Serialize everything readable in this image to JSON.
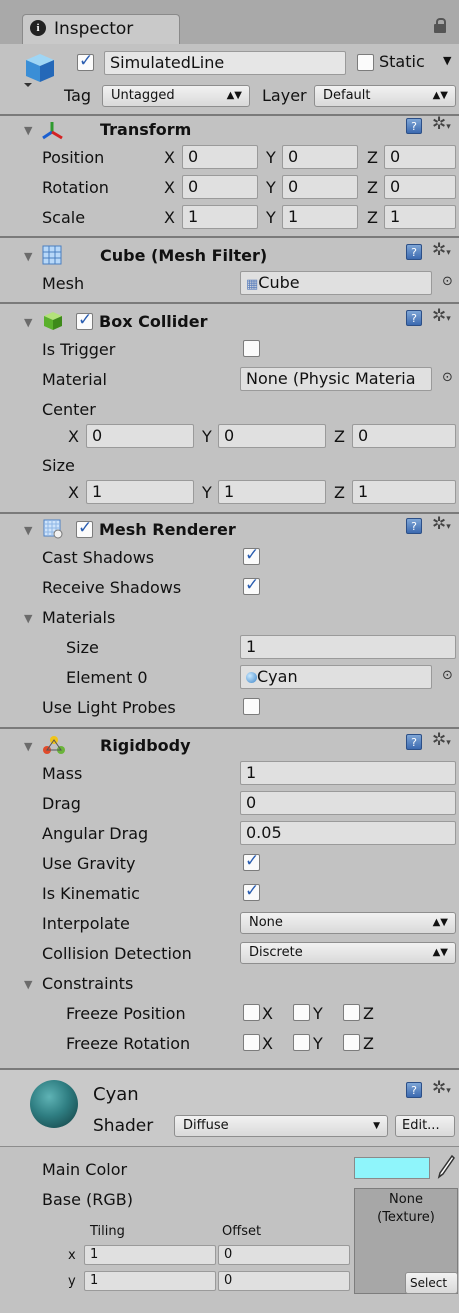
{
  "window": {
    "tab_title": "Inspector"
  },
  "object": {
    "name": "SimulatedLine",
    "static_label": "Static",
    "tag_label": "Tag",
    "tag_value": "Untagged",
    "layer_label": "Layer",
    "layer_value": "Default"
  },
  "transform": {
    "title": "Transform",
    "rows": [
      {
        "label": "Position",
        "x": "0",
        "y": "0",
        "z": "0"
      },
      {
        "label": "Rotation",
        "x": "0",
        "y": "0",
        "z": "0"
      },
      {
        "label": "Scale",
        "x": "1",
        "y": "1",
        "z": "1"
      }
    ]
  },
  "axes": {
    "x": "X",
    "y": "Y",
    "z": "Z",
    "lx": "x",
    "ly": "y"
  },
  "mesh_filter": {
    "title": "Cube (Mesh Filter)",
    "mesh_label": "Mesh",
    "mesh_value": "Cube"
  },
  "box_collider": {
    "title": "Box Collider",
    "is_trigger_label": "Is Trigger",
    "material_label": "Material",
    "material_value": "None (Physic Materia",
    "center_label": "Center",
    "center": {
      "x": "0",
      "y": "0",
      "z": "0"
    },
    "size_label": "Size",
    "size": {
      "x": "1",
      "y": "1",
      "z": "1"
    }
  },
  "mesh_renderer": {
    "title": "Mesh Renderer",
    "cast_shadows_label": "Cast Shadows",
    "cast_shadows": true,
    "receive_shadows_label": "Receive Shadows",
    "receive_shadows": true,
    "materials_label": "Materials",
    "size_label": "Size",
    "size_value": "1",
    "element0_label": "Element 0",
    "element0_value": "Cyan",
    "light_probes_label": "Use Light Probes",
    "light_probes": false
  },
  "rigidbody": {
    "title": "Rigidbody",
    "mass_label": "Mass",
    "mass": "1",
    "drag_label": "Drag",
    "drag": "0",
    "angular_drag_label": "Angular Drag",
    "angular_drag": "0.05",
    "use_gravity_label": "Use Gravity",
    "use_gravity": true,
    "is_kinematic_label": "Is Kinematic",
    "is_kinematic": true,
    "interpolate_label": "Interpolate",
    "interpolate": "None",
    "collision_label": "Collision Detection",
    "collision": "Discrete",
    "constraints_label": "Constraints",
    "freeze_position_label": "Freeze Position",
    "freeze_rotation_label": "Freeze Rotation"
  },
  "material": {
    "name": "Cyan",
    "shader_label": "Shader",
    "shader_value": "Diffuse",
    "edit_label": "Edit...",
    "main_color_label": "Main Color",
    "main_color": "#8ff5fb",
    "base_label": "Base (RGB)",
    "tiling_label": "Tiling",
    "offset_label": "Offset",
    "tiling_x": "1",
    "tiling_y": "1",
    "offset_x": "0",
    "offset_y": "0",
    "texture_none": "None",
    "texture_type": "(Texture)",
    "select_label": "Select"
  },
  "icons": [
    "info-icon",
    "lock-icon",
    "cube-object-icon",
    "transform-axis-icon",
    "mesh-grid-icon",
    "green-cube-icon",
    "renderer-icon",
    "rigidbody-icon",
    "help-icon",
    "gear-icon",
    "target-icon",
    "eyedropper-icon",
    "sphere-icon"
  ]
}
